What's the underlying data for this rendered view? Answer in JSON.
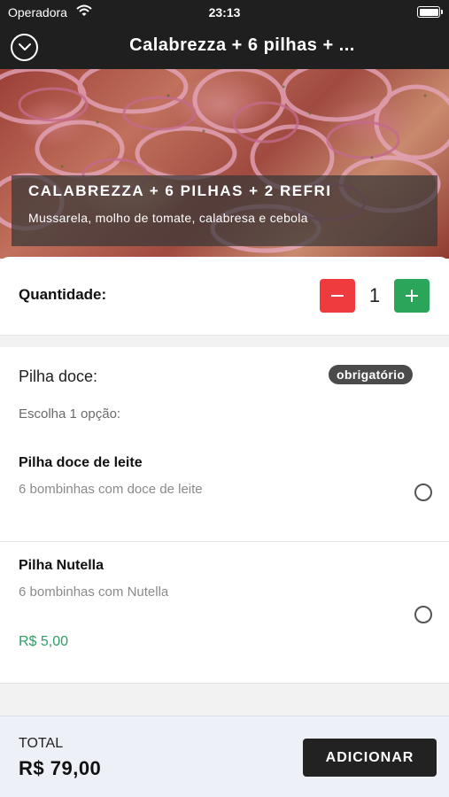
{
  "status_bar": {
    "carrier": "Operadora",
    "time": "23:13"
  },
  "nav": {
    "title": "Calabrezza + 6 pilhas + ...",
    "close_icon": "chevron-down-circle-icon"
  },
  "product": {
    "name": "CALABREZZA + 6 PILHAS + 2 REFRI",
    "description": "Mussarela, molho de tomate, calabresa e cebola"
  },
  "quantity": {
    "label": "Quantidade:",
    "value": "1",
    "minus_icon": "minus-icon",
    "plus_icon": "plus-icon",
    "minus_color": "#ef3b3e",
    "plus_color": "#2aa55a"
  },
  "option_group": {
    "title": "Pilha doce:",
    "badge": "obrigatório",
    "hint": "Escolha 1 opção:",
    "options": [
      {
        "name": "Pilha doce de leite",
        "description": "6 bombinhas com doce de leite",
        "selected": false
      },
      {
        "name": "Pilha Nutella",
        "description": "6 bombinhas com Nutella",
        "price": "R$ 5,00",
        "selected": false
      }
    ]
  },
  "footer": {
    "total_label": "TOTAL",
    "total_value": "R$ 79,00",
    "add_button": "ADICIONAR"
  }
}
